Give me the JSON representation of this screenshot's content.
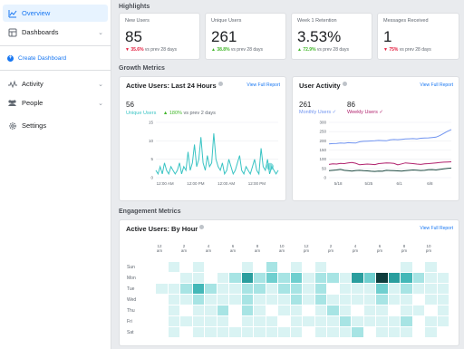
{
  "sidebar": {
    "items": [
      {
        "label": "Overview",
        "icon": "chart-icon",
        "active": true
      },
      {
        "label": "Dashboards",
        "icon": "dashboard-icon",
        "chevron": true
      },
      {
        "label": "Activity",
        "icon": "activity-icon",
        "chevron": true
      },
      {
        "label": "People",
        "icon": "people-icon",
        "chevron": true
      },
      {
        "label": "Settings",
        "icon": "gear-icon"
      }
    ],
    "create_dashboard": "Create Dashboard"
  },
  "highlights": {
    "title": "Highlights",
    "metrics": [
      {
        "label": "New Users",
        "value": "85",
        "arrow": "▼",
        "delta": "35.6%",
        "direction": "down",
        "suffix": "vs prev 28 days"
      },
      {
        "label": "Unique Users",
        "value": "261",
        "arrow": "▲",
        "delta": "38.8%",
        "direction": "up",
        "suffix": "vs prev 28 days"
      },
      {
        "label": "Week 1 Retention",
        "value": "3.53%",
        "arrow": "▲",
        "delta": "72.9%",
        "direction": "up",
        "suffix": "vs prev 28 days"
      },
      {
        "label": "Messages Received",
        "value": "1",
        "arrow": "▼",
        "delta": "75%",
        "direction": "down",
        "suffix": "vs prev 28 days"
      }
    ]
  },
  "growth": {
    "title": "Growth Metrics",
    "active_users": {
      "title": "Active Users: Last 24 Hours",
      "link": "View Full Report",
      "count": "56",
      "count_label": "Unique Users",
      "delta": "▲ 180%",
      "delta_suffix": "vs prev 2 days"
    },
    "user_activity": {
      "title": "User Activity",
      "link": "View Full Report",
      "monthly_value": "261",
      "monthly_label": "Monthly Users",
      "weekly_value": "86",
      "weekly_label": "Weekly Users"
    }
  },
  "engagement": {
    "title": "Engagement Metrics",
    "by_hour": {
      "title": "Active Users: By Hour",
      "link": "View Full Report"
    }
  },
  "colors": {
    "accent": "#1877f2",
    "teal": "#3ac4c4",
    "monthly": "#6f93f0",
    "weekly": "#b0206c",
    "dark": "#1e4a42"
  },
  "chart_data": [
    {
      "type": "line",
      "x_ticks": [
        "12:00 AM",
        "12:00 PM",
        "12:00 AM",
        "12:00 PM"
      ],
      "yticks": [
        0,
        5,
        10,
        15
      ],
      "ylim": [
        0,
        15
      ],
      "series": [
        {
          "name": "Unique Users",
          "values": [
            2,
            1,
            3,
            1,
            4,
            2,
            1,
            3,
            2,
            1,
            2,
            4,
            1,
            3,
            2,
            7,
            2,
            4,
            9,
            3,
            5,
            11,
            4,
            2,
            6,
            3,
            4,
            12,
            5,
            3,
            2,
            4,
            1,
            2,
            5,
            3,
            1,
            2,
            4,
            6,
            2,
            1,
            3,
            2,
            1,
            3,
            5,
            2,
            1,
            8,
            3,
            2,
            5,
            1,
            3,
            2,
            1,
            2
          ]
        }
      ]
    },
    {
      "type": "line",
      "x_ticks": [
        "5/18",
        "5/25",
        "6/1",
        "6/8"
      ],
      "yticks": [
        0,
        50,
        100,
        150,
        200,
        250,
        300
      ],
      "ylim": [
        0,
        300
      ],
      "series": [
        {
          "name": "Monthly Users",
          "values": [
            183,
            185,
            186,
            188,
            187,
            190,
            189,
            188,
            195,
            197,
            198,
            199,
            200,
            202,
            201,
            200,
            205,
            207,
            206,
            208,
            210,
            211,
            212,
            210,
            214,
            215,
            216,
            218,
            220,
            228,
            240,
            252,
            261
          ]
        },
        {
          "name": "Weekly Users",
          "values": [
            72,
            75,
            74,
            77,
            76,
            80,
            82,
            78,
            70,
            72,
            74,
            73,
            71,
            76,
            78,
            80,
            79,
            77,
            70,
            75,
            80,
            78,
            76,
            74,
            72,
            75,
            76,
            78,
            80,
            82,
            84,
            85,
            86
          ]
        },
        {
          "name": "",
          "values": [
            38,
            40,
            42,
            45,
            40,
            38,
            36,
            39,
            40,
            38,
            37,
            35,
            34,
            36,
            35,
            40,
            39,
            38,
            37,
            36,
            38,
            40,
            42,
            41,
            39,
            40,
            43,
            44,
            42,
            45,
            48,
            50,
            52
          ]
        }
      ]
    },
    {
      "type": "heatmap",
      "x_ticks": [
        [
          "12",
          "am"
        ],
        [
          "2",
          "am"
        ],
        [
          "4",
          "am"
        ],
        [
          "6",
          "am"
        ],
        [
          "8",
          "am"
        ],
        [
          "10",
          "am"
        ],
        [
          "12",
          "pm"
        ],
        [
          "2",
          "pm"
        ],
        [
          "4",
          "pm"
        ],
        [
          "6",
          "pm"
        ],
        [
          "8",
          "pm"
        ],
        [
          "10",
          "pm"
        ]
      ],
      "y_categories": [
        "Sun",
        "Mon",
        "Tue",
        "Wed",
        "Thu",
        "Fri",
        "Sat"
      ],
      "values": [
        [
          0,
          1,
          0,
          1,
          0,
          0,
          0,
          1,
          0,
          2,
          0,
          1,
          0,
          1,
          0,
          0,
          0,
          0,
          0,
          0,
          1,
          0,
          1,
          0
        ],
        [
          0,
          0,
          1,
          1,
          0,
          1,
          2,
          5,
          2,
          3,
          2,
          3,
          1,
          2,
          2,
          1,
          5,
          3,
          8,
          5,
          4,
          2,
          1,
          1
        ],
        [
          1,
          1,
          2,
          4,
          2,
          1,
          1,
          2,
          2,
          1,
          2,
          2,
          1,
          2,
          0,
          1,
          1,
          1,
          3,
          1,
          2,
          1,
          1,
          1
        ],
        [
          0,
          1,
          1,
          2,
          1,
          1,
          1,
          2,
          1,
          1,
          1,
          2,
          1,
          2,
          1,
          1,
          1,
          1,
          2,
          1,
          1,
          0,
          1,
          1
        ],
        [
          0,
          1,
          0,
          1,
          1,
          2,
          0,
          2,
          1,
          0,
          1,
          1,
          0,
          1,
          2,
          1,
          0,
          1,
          1,
          0,
          1,
          1,
          0,
          1
        ],
        [
          0,
          1,
          1,
          1,
          1,
          1,
          0,
          1,
          1,
          1,
          0,
          1,
          1,
          1,
          1,
          2,
          1,
          1,
          1,
          1,
          2,
          0,
          1,
          1
        ],
        [
          0,
          1,
          0,
          1,
          1,
          1,
          1,
          1,
          1,
          1,
          1,
          1,
          0,
          1,
          1,
          1,
          2,
          0,
          1,
          1,
          1,
          0,
          1,
          0
        ]
      ]
    }
  ]
}
